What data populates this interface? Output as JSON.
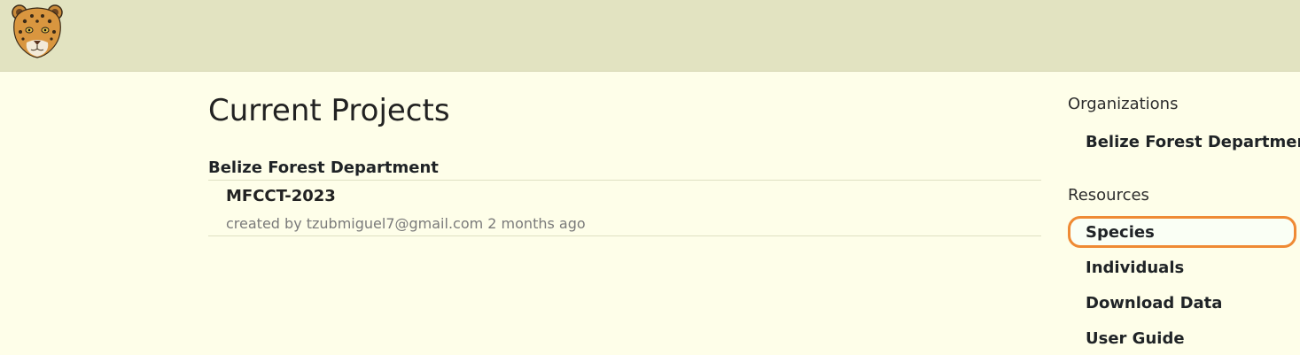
{
  "header": {
    "logo_icon": "jaguar-logo"
  },
  "main": {
    "title": "Current Projects",
    "organization": "Belize Forest Department",
    "projects": [
      {
        "name": "MFCCT-2023",
        "meta": "created by tzubmiguel7@gmail.com 2 months ago"
      }
    ]
  },
  "sidebar": {
    "organizations_heading": "Organizations",
    "organizations": [
      "Belize Forest Department"
    ],
    "resources_heading": "Resources",
    "resources": [
      "Species",
      "Individuals",
      "Download Data",
      "User Guide"
    ],
    "highlight_color": "#ef8a34"
  }
}
